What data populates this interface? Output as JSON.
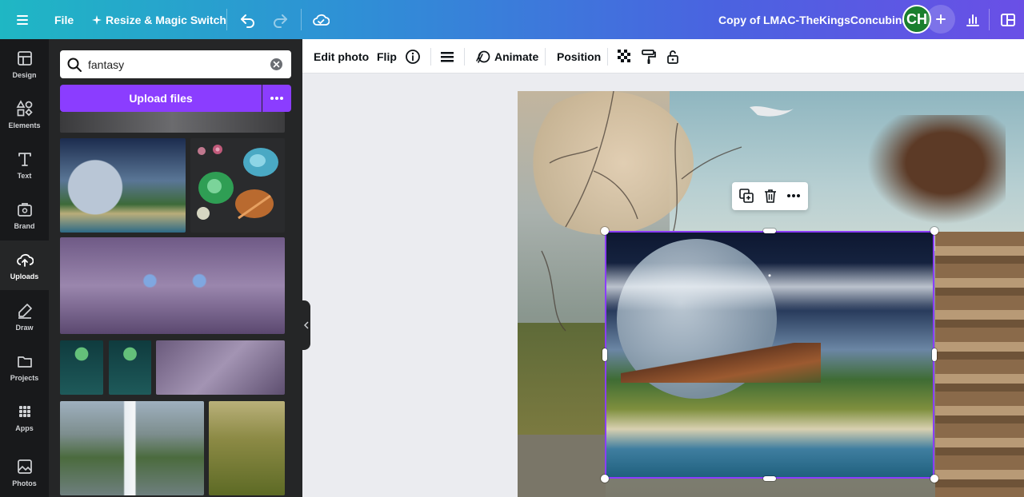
{
  "topbar": {
    "file_label": "File",
    "resize_label": "Resize & Magic Switch",
    "doc_title": "Copy of LMAC-TheKingsConcubine",
    "avatar_initials": "CH",
    "gradient_start": "#1fb7c4",
    "gradient_end": "#6a4fe6"
  },
  "rail": {
    "items": [
      {
        "label": "Design",
        "icon": "layout-icon"
      },
      {
        "label": "Elements",
        "icon": "shapes-icon"
      },
      {
        "label": "Text",
        "icon": "text-icon"
      },
      {
        "label": "Brand",
        "icon": "brand-icon"
      },
      {
        "label": "Uploads",
        "icon": "cloud-upload-icon"
      },
      {
        "label": "Draw",
        "icon": "pen-icon"
      },
      {
        "label": "Projects",
        "icon": "folder-icon"
      },
      {
        "label": "Apps",
        "icon": "apps-icon"
      },
      {
        "label": "Photos",
        "icon": "image-icon"
      }
    ],
    "active": "Uploads"
  },
  "panel": {
    "search_value": "fantasy",
    "upload_label": "Upload files",
    "accent": "#8b3dff"
  },
  "toolbar": {
    "edit_photo": "Edit photo",
    "flip": "Flip",
    "animate": "Animate",
    "position": "Position"
  }
}
